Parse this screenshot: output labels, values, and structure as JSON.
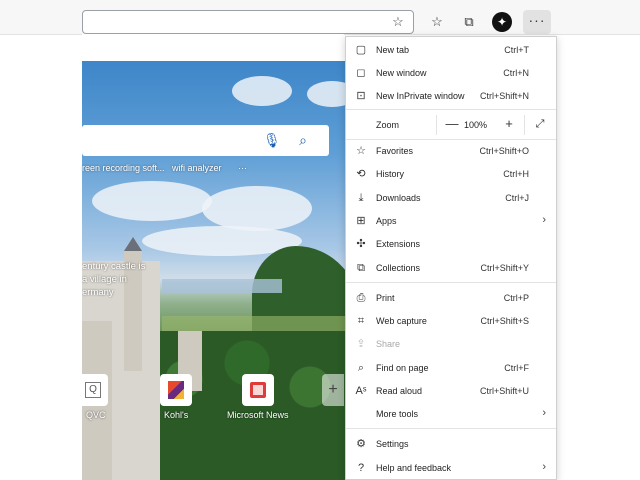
{
  "toolbar": {
    "favorite_icon": "star-add-icon",
    "icons": [
      "favorites-icon",
      "collections-icon",
      "profile-icon",
      "more-icon"
    ],
    "more_label": "···"
  },
  "ntp": {
    "recent_searches": [
      "reen recording soft...",
      "wifi analyzer"
    ],
    "recent_more": "···",
    "caption_lines": [
      "entury castle is",
      "a village in",
      "ermany"
    ],
    "tiles": [
      {
        "label": "QVC",
        "icon": "qvc-icon"
      },
      {
        "label": "Kohl's",
        "icon": "kohls-icon"
      },
      {
        "label": "Microsoft News",
        "icon": "microsoft-news-icon"
      }
    ]
  },
  "menu": {
    "new_tab": {
      "label": "New tab",
      "shortcut": "Ctrl+T"
    },
    "new_window": {
      "label": "New window",
      "shortcut": "Ctrl+N"
    },
    "new_inprivate": {
      "label": "New InPrivate window",
      "shortcut": "Ctrl+Shift+N"
    },
    "zoom": {
      "label": "Zoom",
      "value": "100%",
      "minus": "—",
      "plus": "+"
    },
    "favorites": {
      "label": "Favorites",
      "shortcut": "Ctrl+Shift+O"
    },
    "history": {
      "label": "History",
      "shortcut": "Ctrl+H"
    },
    "downloads": {
      "label": "Downloads",
      "shortcut": "Ctrl+J"
    },
    "apps": {
      "label": "Apps"
    },
    "extensions": {
      "label": "Extensions"
    },
    "collections": {
      "label": "Collections",
      "shortcut": "Ctrl+Shift+Y"
    },
    "print": {
      "label": "Print",
      "shortcut": "Ctrl+P"
    },
    "web_capture": {
      "label": "Web capture",
      "shortcut": "Ctrl+Shift+S"
    },
    "share": {
      "label": "Share"
    },
    "find_on_page": {
      "label": "Find on page",
      "shortcut": "Ctrl+F"
    },
    "read_aloud": {
      "label": "Read aloud",
      "shortcut": "Ctrl+Shift+U"
    },
    "more_tools": {
      "label": "More tools"
    },
    "settings": {
      "label": "Settings"
    },
    "help_feedback": {
      "label": "Help and feedback"
    }
  }
}
